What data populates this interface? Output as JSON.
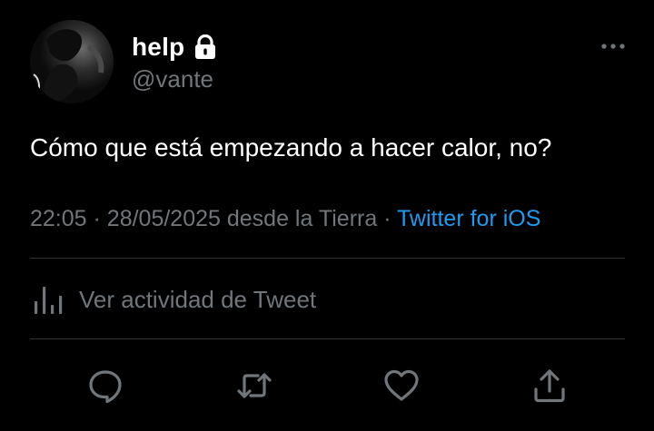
{
  "user": {
    "display_name": "help",
    "handle": "@vante",
    "avatar_icon": "avatar-photo",
    "protected_icon": "lock-icon"
  },
  "tweet": {
    "text": "Cómo que está empezando a hacer calor, no?",
    "time": "22:05",
    "separator": "·",
    "date": "28/05/2025",
    "location": "desde la Tierra",
    "source": "Twitter for iOS"
  },
  "activity": {
    "label": "Ver actividad de Tweet",
    "icon": "bar-chart-icon"
  },
  "actions": [
    {
      "name": "reply",
      "icon": "reply-icon"
    },
    {
      "name": "retweet",
      "icon": "retweet-icon"
    },
    {
      "name": "like",
      "icon": "heart-icon"
    },
    {
      "name": "share",
      "icon": "share-icon"
    }
  ],
  "colors": {
    "background": "#000000",
    "text_primary": "#ffffff",
    "text_secondary": "#71767b",
    "accent": "#1d9bf0",
    "divider": "#2f3336"
  }
}
